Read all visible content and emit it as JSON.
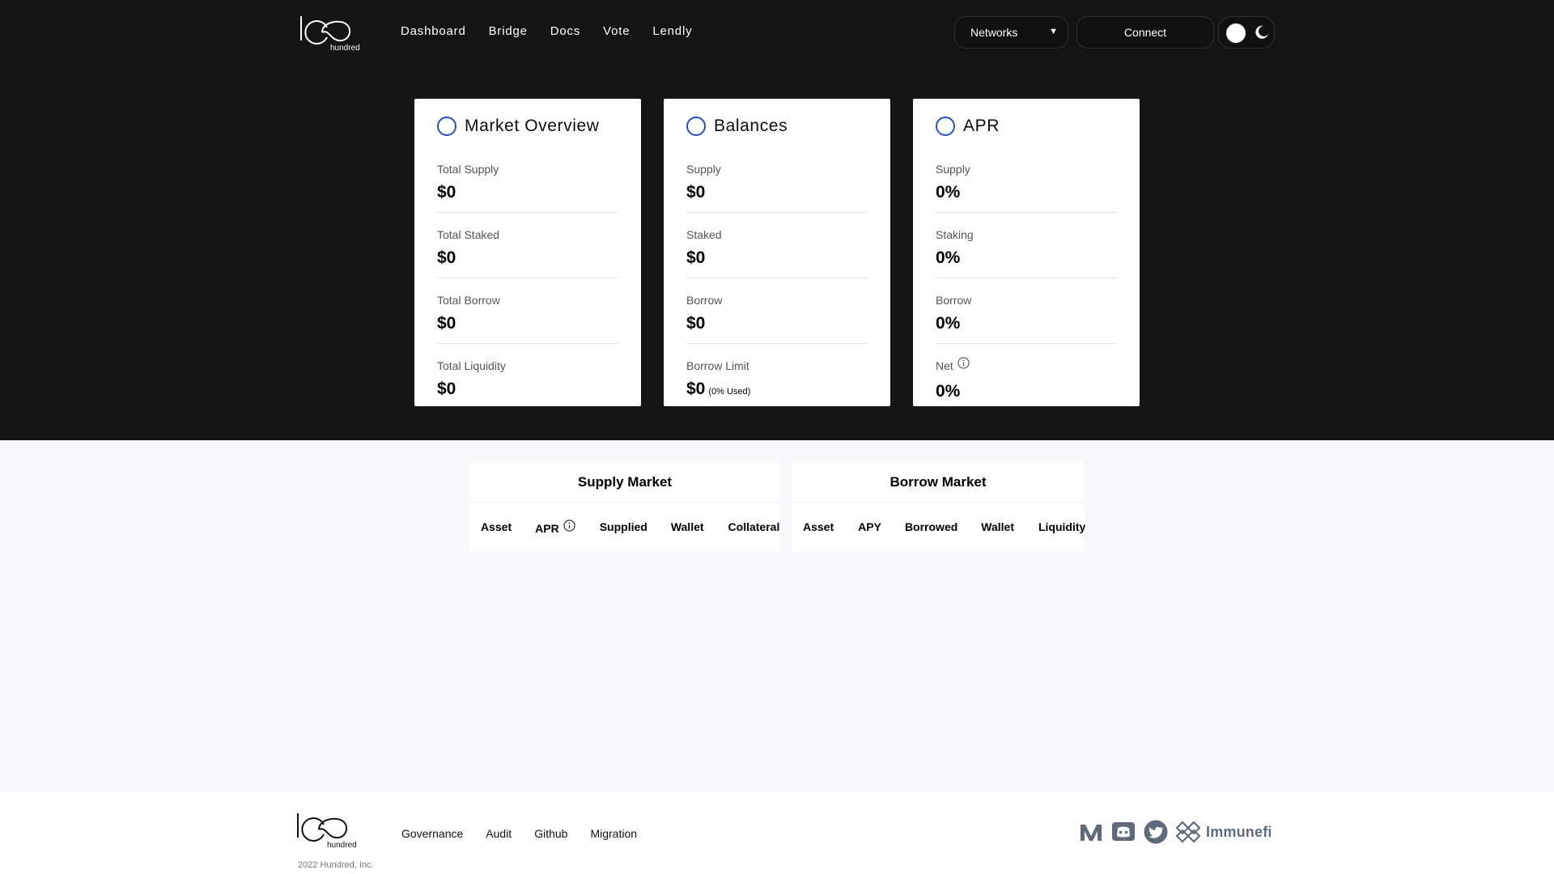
{
  "brand": {
    "logo_text": "hundred"
  },
  "nav": {
    "links": [
      "Dashboard",
      "Bridge",
      "Docs",
      "Vote",
      "Lendly"
    ],
    "networks_label": "Networks",
    "connect_label": "Connect"
  },
  "cards": {
    "overview": {
      "title": "Market Overview",
      "stats": [
        {
          "label": "Total Supply",
          "value": "$0"
        },
        {
          "label": "Total Staked",
          "value": "$0"
        },
        {
          "label": "Total Borrow",
          "value": "$0"
        },
        {
          "label": "Total Liquidity",
          "value": "$0"
        }
      ]
    },
    "balances": {
      "title": "Balances",
      "stats": [
        {
          "label": "Supply",
          "value": "$0"
        },
        {
          "label": "Staked",
          "value": "$0"
        },
        {
          "label": "Borrow",
          "value": "$0"
        },
        {
          "label": "Borrow Limit",
          "value": "$0",
          "note": "(0% Used)"
        }
      ]
    },
    "apr": {
      "title": "APR",
      "stats": [
        {
          "label": "Supply",
          "value": "0%"
        },
        {
          "label": "Staking",
          "value": "0%"
        },
        {
          "label": "Borrow",
          "value": "0%"
        },
        {
          "label": "Net",
          "value": "0%"
        }
      ]
    }
  },
  "supply_market": {
    "title": "Supply Market",
    "columns": [
      "Asset",
      "APR",
      "Supplied",
      "Wallet",
      "Collateral"
    ]
  },
  "borrow_market": {
    "title": "Borrow Market",
    "columns": [
      "Asset",
      "APY",
      "Borrowed",
      "Wallet",
      "Liquidity"
    ]
  },
  "footer": {
    "links": [
      "Governance",
      "Audit",
      "Github",
      "Migration"
    ],
    "copyright": "2022 Hundred, Inc.",
    "immunefi_label": "Immunefi"
  },
  "colors": {
    "accent": "#1d4ed8",
    "dark_bg": "#141414",
    "light_bg": "#f7f8fa",
    "social_grey": "#5f6b7c"
  },
  "icons": [
    "info-icon",
    "moon-icon",
    "medium-icon",
    "discord-icon",
    "twitter-icon",
    "immunefi-icon"
  ]
}
